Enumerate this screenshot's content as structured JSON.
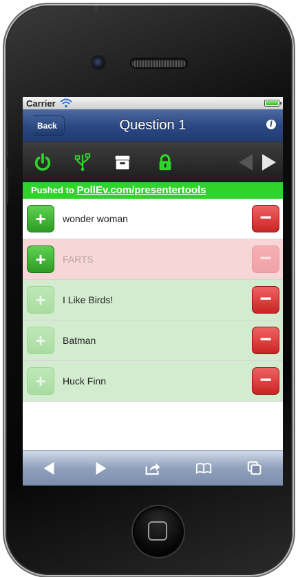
{
  "status_bar": {
    "carrier": "Carrier"
  },
  "nav": {
    "back_label": "Back",
    "title": "Question 1",
    "info_glyph": "i"
  },
  "toolbar": {
    "icons": [
      "power-icon",
      "usb-icon",
      "archive-icon",
      "lock-icon",
      "arrow-left-icon",
      "arrow-right-icon"
    ],
    "colors": {
      "active": "#2fd42a",
      "disabled": "#555555",
      "enabled": "#e6e6e6"
    }
  },
  "pushed_banner": {
    "prefix": "Pushed to ",
    "link": "PollEv.com/presentertools"
  },
  "responses": [
    {
      "label": "wonder woman",
      "state": "neutral"
    },
    {
      "label": "FARTS",
      "state": "rejected"
    },
    {
      "label": "I Like Birds!",
      "state": "accepted"
    },
    {
      "label": "Batman",
      "state": "accepted"
    },
    {
      "label": "Huck Finn",
      "state": "accepted"
    }
  ],
  "bottom_bar": {
    "icons": [
      "back-icon",
      "forward-icon",
      "share-icon",
      "bookmarks-icon",
      "tabs-icon"
    ]
  },
  "button_glyphs": {
    "plus": "+",
    "minus": "−"
  }
}
